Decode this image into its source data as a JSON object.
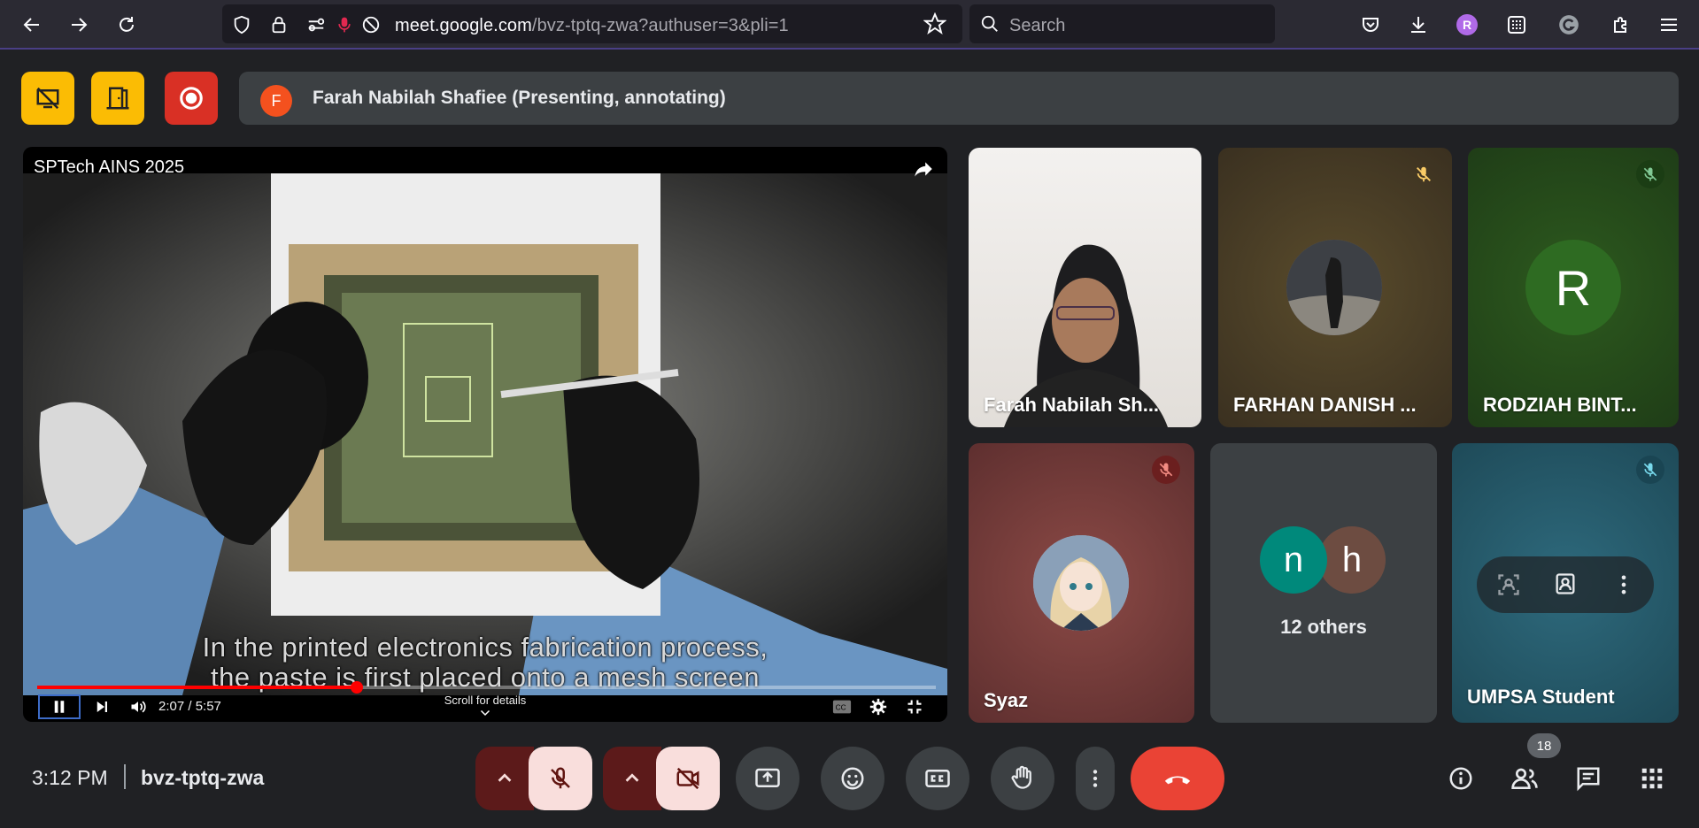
{
  "browser": {
    "url_host": "meet.google.com",
    "url_path": "/bvz-tptq-zwa?authuser=3&pli=1",
    "search_placeholder": "Search",
    "profile_initial": "R"
  },
  "meet": {
    "presenter": {
      "initial": "F",
      "label": "Farah Nabilah Shafiee (Presenting, annotating)"
    },
    "presentation": {
      "video_title": "SPTech AINS 2025",
      "subtitle_line1": "In the printed electronics fabrication process,",
      "subtitle_line2": "the paste is first placed onto a mesh screen",
      "time": "2:07 / 5:57",
      "progress": 0.356,
      "scroll_hint": "Scroll for details"
    },
    "tiles": [
      {
        "name": "Farah Nabilah Sh..."
      },
      {
        "name": "FARHAN DANISH ..."
      },
      {
        "name": "RODZIAH BINT...",
        "initial": "R"
      },
      {
        "name": "Syaz"
      },
      {
        "others_label": "12 others",
        "avatar1": "n",
        "avatar2": "h"
      },
      {
        "name": "UMPSA Student"
      }
    ],
    "clock": "3:12 PM",
    "meeting_code": "bvz-tptq-zwa",
    "participants_count": "18",
    "colors": {
      "accent_yellow": "#fbbc04",
      "record_red": "#d93025",
      "hangup_red": "#ea4335",
      "muted_btn": "#f9dedc"
    }
  }
}
